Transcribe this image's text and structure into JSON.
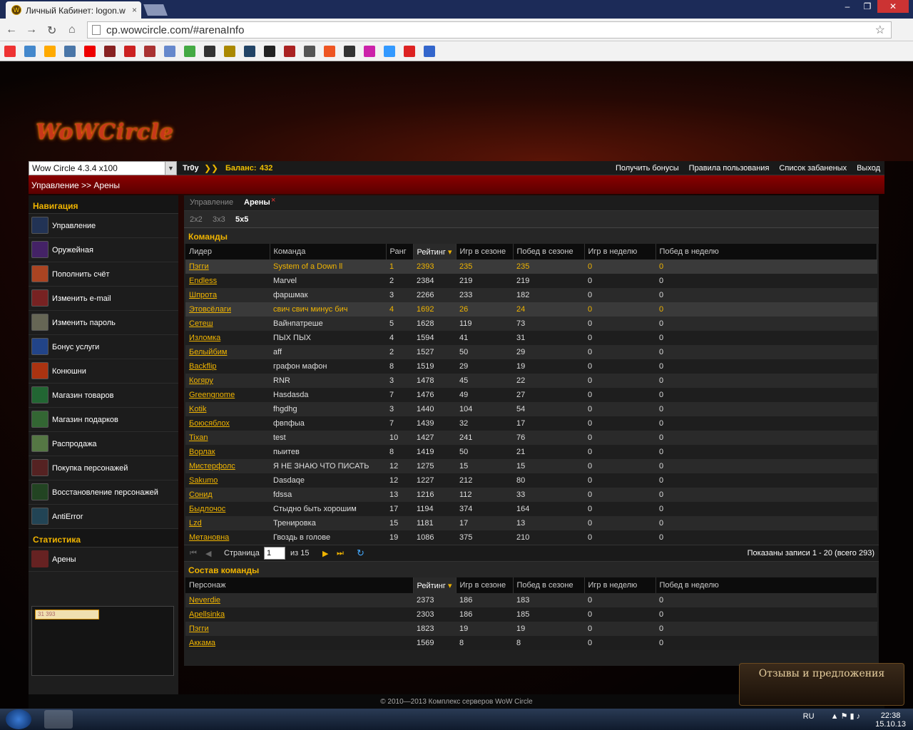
{
  "browser": {
    "tab_title": "Личный Кабинет: logon.w",
    "tab_close": "×",
    "url": "cp.wowcircle.com/#arenaInfo",
    "win_min": "–",
    "win_max": "❐",
    "win_close": "✕",
    "back": "←",
    "forward": "→",
    "reload": "↻",
    "home": "⌂",
    "star": "☆"
  },
  "site": {
    "logo": "WoWCircle",
    "realm": "Wow Circle 4.3.4 x100",
    "user": "Tr0y",
    "balance_label": "Баланс:",
    "balance": "432",
    "links": [
      "Получить бонусы",
      "Правила пользования",
      "Список забаненых",
      "Выход"
    ],
    "breadcrumb": "Управление >> Арены"
  },
  "sidebar": {
    "nav_title": "Навигация",
    "items": [
      "Управление",
      "Оружейная",
      "Пополнить счёт",
      "Изменить e-mail",
      "Изменить пароль",
      "Бонус услуги",
      "Конюшни",
      "Магазин товаров",
      "Магазин подарков",
      "Распродажа",
      "Покупка персонажей",
      "Восстановление персонажей",
      "AntiError"
    ],
    "stats_title": "Статистика",
    "stats_items": [
      "Арены"
    ],
    "counter": "31 393"
  },
  "main": {
    "tabs": [
      "Управление",
      "Арены"
    ],
    "tab_close": "×",
    "subtabs": [
      "2x2",
      "3x3",
      "5x5"
    ],
    "teams_title": "Команды",
    "teams_headers": [
      "Лидер",
      "Команда",
      "Ранг",
      "Рейтинг",
      "Игр в сезоне",
      "Побед в сезоне",
      "Игр в неделю",
      "Побед в неделю"
    ],
    "teams": [
      [
        "Пэгги",
        "System of a Down ll",
        "1",
        "2393",
        "235",
        "235",
        "0",
        "0"
      ],
      [
        "Endless",
        "Marvel",
        "2",
        "2384",
        "219",
        "219",
        "0",
        "0"
      ],
      [
        "Шпрота",
        "фаршмак",
        "3",
        "2266",
        "233",
        "182",
        "0",
        "0"
      ],
      [
        "Этовсёлаги",
        "свич свич минус бич",
        "4",
        "1692",
        "26",
        "24",
        "0",
        "0"
      ],
      [
        "Сетеш",
        "Вайнпатреше",
        "5",
        "1628",
        "119",
        "73",
        "0",
        "0"
      ],
      [
        "Изломка",
        "ПЫХ ПЫХ",
        "4",
        "1594",
        "41",
        "31",
        "0",
        "0"
      ],
      [
        "Белыйбим",
        "aff",
        "2",
        "1527",
        "50",
        "29",
        "0",
        "0"
      ],
      [
        "Backflip",
        "графон мафон",
        "8",
        "1519",
        "29",
        "19",
        "0",
        "0"
      ],
      [
        "Когяру",
        "RNR",
        "3",
        "1478",
        "45",
        "22",
        "0",
        "0"
      ],
      [
        "Greengnome",
        "Hasdasda",
        "7",
        "1476",
        "49",
        "27",
        "0",
        "0"
      ],
      [
        "Kotik",
        "fhgdhg",
        "3",
        "1440",
        "104",
        "54",
        "0",
        "0"
      ],
      [
        "Боюсяблох",
        "фвпфыа",
        "7",
        "1439",
        "32",
        "17",
        "0",
        "0"
      ],
      [
        "Tixan",
        "test",
        "10",
        "1427",
        "241",
        "76",
        "0",
        "0"
      ],
      [
        "Ворлак",
        "пыитев",
        "8",
        "1419",
        "50",
        "21",
        "0",
        "0"
      ],
      [
        "Мистерфолс",
        "Я НЕ ЗНАЮ ЧТО ПИСАТЬ",
        "12",
        "1275",
        "15",
        "15",
        "0",
        "0"
      ],
      [
        "Sakumo",
        "Dasdaqe",
        "12",
        "1227",
        "212",
        "80",
        "0",
        "0"
      ],
      [
        "Сонид",
        "fdssa",
        "13",
        "1216",
        "112",
        "33",
        "0",
        "0"
      ],
      [
        "Быдлочос",
        "Стыдно быть хорошим",
        "17",
        "1194",
        "374",
        "164",
        "0",
        "0"
      ],
      [
        "Lzd",
        "Тренировка",
        "15",
        "1181",
        "17",
        "13",
        "0",
        "0"
      ],
      [
        "Метановна",
        "Гвоздь в голове",
        "19",
        "1086",
        "375",
        "210",
        "0",
        "0"
      ]
    ],
    "pager": {
      "page_label": "Страница",
      "page": "1",
      "of": "из 15",
      "info": "Показаны записи 1 - 20 (всего 293)"
    },
    "roster_title": "Состав команды",
    "roster_headers": [
      "Персонаж",
      "Рейтинг",
      "Игр в сезоне",
      "Побед в сезоне",
      "Игр в неделю",
      "Побед в неделю"
    ],
    "roster": [
      [
        "Neverdie",
        "2373",
        "186",
        "183",
        "0",
        "0"
      ],
      [
        "Apellsinka",
        "2303",
        "186",
        "185",
        "0",
        "0"
      ],
      [
        "Пэгги",
        "1823",
        "19",
        "19",
        "0",
        "0"
      ],
      [
        "Аккама",
        "1569",
        "8",
        "8",
        "0",
        "0"
      ]
    ]
  },
  "footer": "© 2010—2013 Комплекс серверов WoW Circle",
  "feedback": "Отзывы и предложения",
  "taskbar": {
    "lang": "RU",
    "time": "22:38",
    "date": "15.10.13"
  }
}
